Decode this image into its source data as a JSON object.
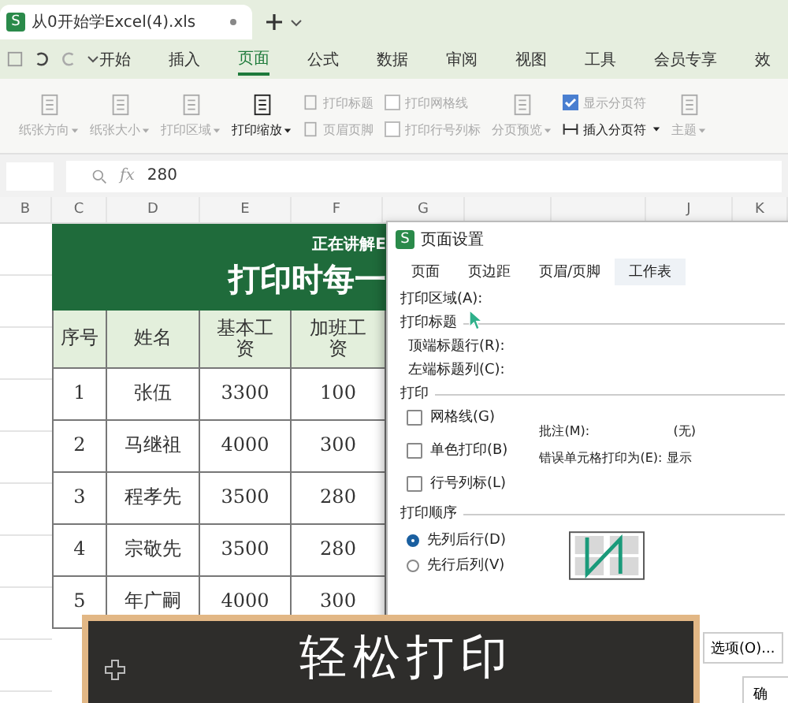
{
  "file_tab": {
    "logo": "S",
    "title": "从0开始学Excel(4).xls"
  },
  "menu": [
    {
      "label": "开始",
      "selected": false
    },
    {
      "label": "插入",
      "selected": false
    },
    {
      "label": "页面",
      "selected": true
    },
    {
      "label": "公式",
      "selected": false
    },
    {
      "label": "数据",
      "selected": false
    },
    {
      "label": "审阅",
      "selected": false
    },
    {
      "label": "视图",
      "selected": false
    },
    {
      "label": "工具",
      "selected": false
    },
    {
      "label": "会员专享",
      "selected": false
    },
    {
      "label": "效",
      "selected": false
    }
  ],
  "ribbon": [
    {
      "kind": "big",
      "label": "纸张方向",
      "disabled": true
    },
    {
      "kind": "big",
      "label": "纸张大小",
      "disabled": true
    },
    {
      "kind": "big",
      "label": "打印区域",
      "disabled": true
    },
    {
      "kind": "big",
      "label": "打印缩放",
      "disabled": false
    },
    {
      "kind": "pair",
      "items": [
        {
          "label": "打印标题",
          "disabled": true
        },
        {
          "label": "页眉页脚",
          "disabled": true
        }
      ]
    },
    {
      "kind": "checks",
      "items": [
        {
          "kind": "check",
          "label": "打印网格线",
          "checked": false
        },
        {
          "kind": "check",
          "label": "打印行号列标",
          "checked": false
        }
      ]
    },
    {
      "kind": "big",
      "label": "分页预览",
      "disabled": true
    },
    {
      "kind": "checks",
      "items": [
        {
          "kind": "check",
          "label": "显示分页符",
          "checked": true
        },
        {
          "kind": "button",
          "label": "插入分页符"
        }
      ]
    },
    {
      "kind": "big",
      "label": "主题",
      "disabled": true
    }
  ],
  "formula_bar": {
    "function_label": "fx",
    "value": "280"
  },
  "column_headers": [
    "B",
    "C",
    "D",
    "E",
    "F",
    "G",
    "J",
    "K"
  ],
  "sheet": {
    "banner_subtitle": "正在讲解E",
    "banner_title": "打印时每一",
    "columns": [
      "序号",
      "姓名",
      "基本工资",
      "加班工资"
    ],
    "rows": [
      [
        "1",
        "张伍",
        "3300",
        "100"
      ],
      [
        "2",
        "马继祖",
        "4000",
        "300"
      ],
      [
        "3",
        "程孝先",
        "3500",
        "280"
      ],
      [
        "4",
        "宗敬先",
        "3500",
        "280"
      ],
      [
        "5",
        "年广嗣",
        "4000",
        "300"
      ]
    ]
  },
  "dialog": {
    "logo": "S",
    "title": "页面设置",
    "tabs": [
      {
        "label": "页面",
        "selected": false
      },
      {
        "label": "页边距",
        "selected": false
      },
      {
        "label": "页眉/页脚",
        "selected": false
      },
      {
        "label": "工作表",
        "selected": true
      }
    ],
    "print_area_label": "打印区域(A):",
    "print_titles_heading": "打印标题",
    "top_rows_label": "顶端标题行(R):",
    "left_columns_label": "左端标题列(C):",
    "print_heading": "打印",
    "checkboxes": [
      {
        "label": "网格线(G)",
        "checked": false
      },
      {
        "label": "单色打印(B)",
        "checked": false
      },
      {
        "label": "行号列标(L)",
        "checked": false
      }
    ],
    "comments_label": "批注(M):",
    "comments_value": "(无)",
    "errors_label": "错误单元格打印为(E):",
    "errors_value": "显示",
    "order_heading": "打印顺序",
    "order_options": [
      {
        "label": "先列后行(D)",
        "selected": true
      },
      {
        "label": "先行后列(V)",
        "selected": false
      }
    ],
    "options_button": "选项(O)...",
    "ok_button": "确"
  },
  "caption": {
    "text": "轻松打印"
  }
}
